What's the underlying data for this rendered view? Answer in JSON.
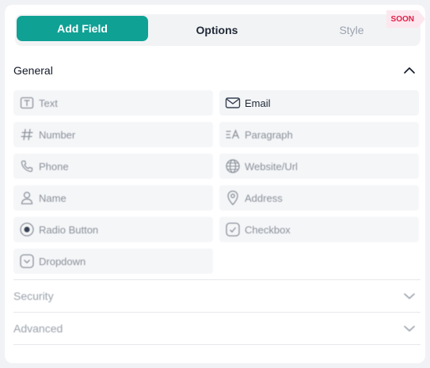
{
  "tabs": {
    "items": [
      {
        "label": "Add Field"
      },
      {
        "label": "Options"
      },
      {
        "label": "Style"
      }
    ],
    "badge": "SOON"
  },
  "sections": {
    "general": {
      "title": "General"
    },
    "security": {
      "title": "Security"
    },
    "advanced": {
      "title": "Advanced"
    }
  },
  "fields": [
    {
      "label": "Text",
      "icon": "text-icon"
    },
    {
      "label": "Email",
      "icon": "email-icon"
    },
    {
      "label": "Number",
      "icon": "hash-icon"
    },
    {
      "label": "Paragraph",
      "icon": "paragraph-icon"
    },
    {
      "label": "Phone",
      "icon": "phone-icon"
    },
    {
      "label": "Website/Url",
      "icon": "globe-icon"
    },
    {
      "label": "Name",
      "icon": "user-icon"
    },
    {
      "label": "Address",
      "icon": "location-pin-icon"
    },
    {
      "label": "Radio Button",
      "icon": "radio-icon"
    },
    {
      "label": "Checkbox",
      "icon": "checkbox-icon"
    },
    {
      "label": "Dropdown",
      "icon": "dropdown-icon"
    }
  ],
  "colors": {
    "accent": "#10a195",
    "badge_text": "#e11d48",
    "badge_bg": "#fde7ee"
  }
}
